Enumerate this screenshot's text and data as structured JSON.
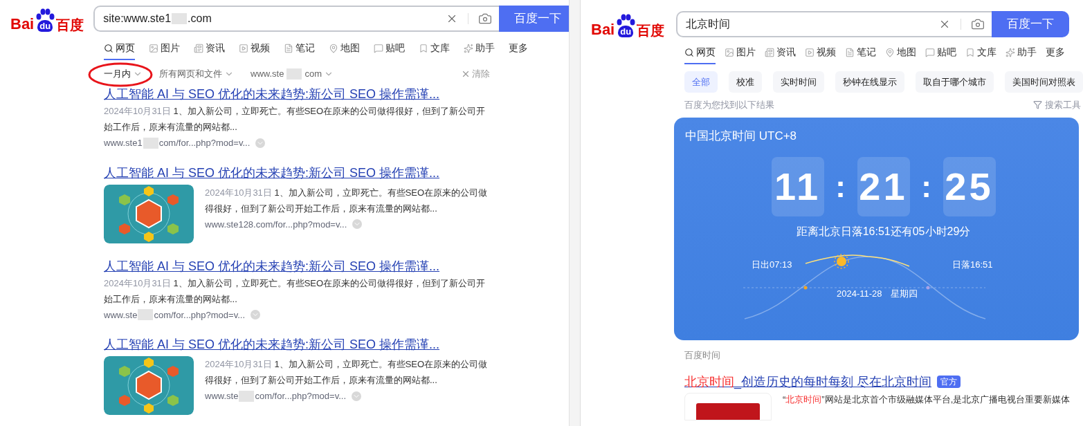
{
  "left": {
    "logo": {
      "left": "Bai",
      "mid": "du",
      "right": "百度"
    },
    "search": {
      "value_parts": [
        "site:www.ste1",
        ".com"
      ],
      "button": "百度一下"
    },
    "tabs": [
      {
        "label": "网页",
        "kind": "search",
        "selected": true
      },
      {
        "label": "图片",
        "kind": "image",
        "selected": false
      },
      {
        "label": "资讯",
        "kind": "news",
        "selected": false
      },
      {
        "label": "视频",
        "kind": "video",
        "selected": false
      },
      {
        "label": "笔记",
        "kind": "note",
        "selected": false
      },
      {
        "label": "地图",
        "kind": "map",
        "selected": false
      },
      {
        "label": "贴吧",
        "kind": "forum",
        "selected": false
      },
      {
        "label": "文库",
        "kind": "doc",
        "selected": false
      },
      {
        "label": "助手",
        "kind": "ai",
        "selected": false
      },
      {
        "label": "更多",
        "kind": "plain",
        "selected": false
      }
    ],
    "filters": [
      {
        "label_parts": [
          "一月内"
        ],
        "circled": true
      },
      {
        "label_parts": [
          "所有网页和文件"
        ],
        "circled": false
      },
      {
        "label_parts": [
          "www.ste",
          "com"
        ],
        "circled": false
      }
    ],
    "clear": "清除",
    "results": [
      {
        "kind": "text",
        "title": "人工智能 AI 与 SEO 优化的未来趋势:新公司 SEO 操作需谨...",
        "date": "2024年10月31日",
        "snippet": "1、加入新公司，立即死亡。有些SEO在原来的公司做得很好，但到了新公司开始工作后，原来有流量的网站都...",
        "url_parts": [
          "www.ste1",
          "com/for...php?mod=v..."
        ]
      },
      {
        "kind": "image",
        "title": "人工智能 AI 与 SEO 优化的未来趋势:新公司 SEO 操作需谨...",
        "date": "2024年10月31日",
        "snippet": "1、加入新公司，立即死亡。有些SEO在原来的公司做得很好，但到了新公司开始工作后，原来有流量的网站都...",
        "url_parts": [
          "www.ste128.com/for...php?mod=v..."
        ]
      },
      {
        "kind": "text",
        "title": "人工智能 AI 与 SEO 优化的未来趋势:新公司 SEO 操作需谨...",
        "date": "2024年10月31日",
        "snippet": "1、加入新公司，立即死亡。有些SEO在原来的公司做得很好，但到了新公司开始工作后，原来有流量的网站都...",
        "url_parts": [
          "www.ste",
          "com/for...php?mod=v..."
        ]
      },
      {
        "kind": "image",
        "title": "人工智能 AI 与 SEO 优化的未来趋势:新公司 SEO 操作需谨...",
        "date": "2024年10月31日",
        "snippet": "1、加入新公司，立即死亡。有些SEO在原来的公司做得很好，但到了新公司开始工作后，原来有流量的网站都...",
        "url_parts": [
          "www.ste",
          "com/for...php?mod=v..."
        ]
      }
    ]
  },
  "right": {
    "logo": {
      "left": "Bai",
      "mid": "du",
      "right": "百度"
    },
    "search": {
      "value_parts": [
        "北京时间"
      ],
      "button": "百度一下"
    },
    "tabs": [
      {
        "label": "网页",
        "kind": "search",
        "selected": true
      },
      {
        "label": "图片",
        "kind": "image",
        "selected": false
      },
      {
        "label": "资讯",
        "kind": "news",
        "selected": false
      },
      {
        "label": "视频",
        "kind": "video",
        "selected": false
      },
      {
        "label": "笔记",
        "kind": "note",
        "selected": false
      },
      {
        "label": "地图",
        "kind": "map",
        "selected": false
      },
      {
        "label": "贴吧",
        "kind": "forum",
        "selected": false
      },
      {
        "label": "文库",
        "kind": "doc",
        "selected": false
      },
      {
        "label": "助手",
        "kind": "ai",
        "selected": false
      },
      {
        "label": "更多",
        "kind": "plain",
        "selected": false
      }
    ],
    "chips": [
      {
        "label": "全部",
        "selected": true
      },
      {
        "label": "校准",
        "selected": false
      },
      {
        "label": "实时时间",
        "selected": false
      },
      {
        "label": "秒钟在线显示",
        "selected": false
      },
      {
        "label": "取自于哪个城市",
        "selected": false
      },
      {
        "label": "美国时间对照表",
        "selected": false
      }
    ],
    "result_count": "百度为您找到以下结果",
    "tools": "搜索工具",
    "clock_card": {
      "title": "中国北京时间 UTC+8",
      "time": [
        "11",
        "21",
        "25"
      ],
      "separator": ":",
      "countdown": "距离北京日落16:51还有05小时29分",
      "sunrise": "日出07:13",
      "sunset": "日落16:51",
      "date": "2024-11-28",
      "weekday": "星期四"
    },
    "card_source": "百度时间",
    "result": {
      "title_highlight": "北京时间",
      "title_rest": "_创造历史的每时每刻 尽在北京时间",
      "badge": "官方",
      "snippet_parts": [
        {
          "text": "“",
          "highlight": false
        },
        {
          "text": "北京时间",
          "highlight": true
        },
        {
          "text": "”网站是北京首个市级融媒体平台,是北京广播电视台重要新媒体",
          "highlight": false
        }
      ]
    }
  }
}
